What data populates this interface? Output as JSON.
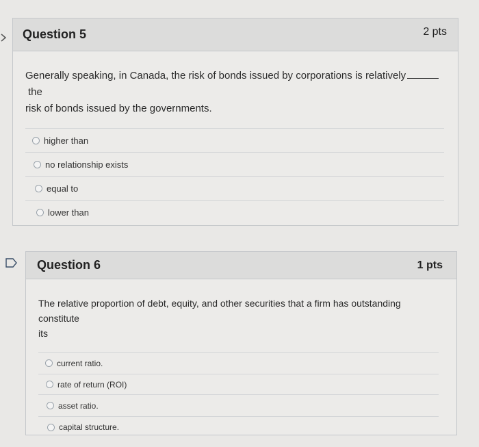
{
  "q5": {
    "title": "Question 5",
    "points": "2 pts",
    "text_before": "Generally speaking, in Canada, the risk of bonds issued by corporations is relatively",
    "text_after": "the",
    "text_line2": "risk of bonds issued by the governments.",
    "options": [
      "higher than",
      "no relationship exists",
      "equal to",
      "lower than"
    ]
  },
  "q6": {
    "title": "Question 6",
    "points": "1 pts",
    "text_line1": "The relative proportion of debt, equity, and other securities that a firm has outstanding constitute",
    "text_line2": "its",
    "options": [
      "current ratio.",
      "rate of return (ROI)",
      "asset ratio.",
      "capital structure."
    ]
  }
}
